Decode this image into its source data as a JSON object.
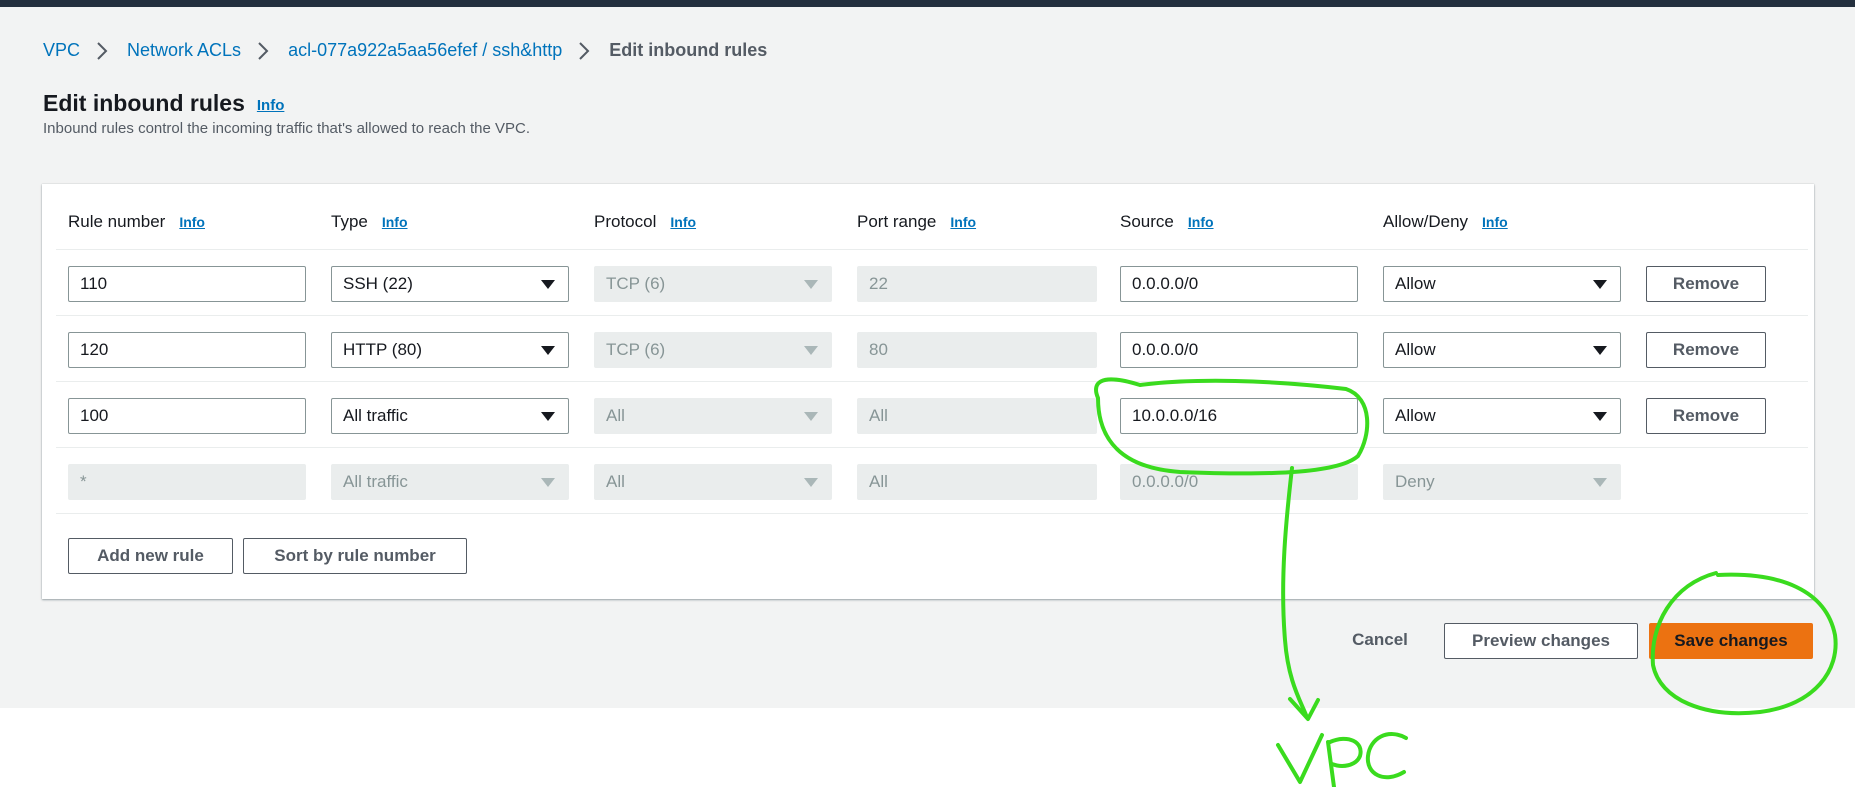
{
  "breadcrumb": {
    "items": [
      "VPC",
      "Network ACLs",
      "acl-077a922a5aa56efef / ssh&http"
    ],
    "current": "Edit inbound rules"
  },
  "page": {
    "title": "Edit inbound rules",
    "info": "Info",
    "subtitle": "Inbound rules control the incoming traffic that's allowed to reach the VPC."
  },
  "table": {
    "columns": [
      {
        "label": "Rule number",
        "info": "Info"
      },
      {
        "label": "Type",
        "info": "Info"
      },
      {
        "label": "Protocol",
        "info": "Info"
      },
      {
        "label": "Port range",
        "info": "Info"
      },
      {
        "label": "Source",
        "info": "Info"
      },
      {
        "label": "Allow/Deny",
        "info": "Info"
      }
    ],
    "rows": [
      {
        "rule_number": "110",
        "type": "SSH (22)",
        "protocol": "TCP (6)",
        "port_range": "22",
        "source": "0.0.0.0/0",
        "action": "Allow",
        "remove": "Remove"
      },
      {
        "rule_number": "120",
        "type": "HTTP (80)",
        "protocol": "TCP (6)",
        "port_range": "80",
        "source": "0.0.0.0/0",
        "action": "Allow",
        "remove": "Remove"
      },
      {
        "rule_number": "100",
        "type": "All traffic",
        "protocol": "All",
        "port_range": "All",
        "source": "10.0.0.0/16",
        "action": "Allow",
        "remove": "Remove"
      },
      {
        "rule_number": "*",
        "type": "All traffic",
        "protocol": "All",
        "port_range": "All",
        "source": "0.0.0.0/0",
        "action": "Deny"
      }
    ],
    "add_rule": "Add new rule",
    "sort_rules": "Sort by rule number"
  },
  "footer": {
    "cancel": "Cancel",
    "preview": "Preview changes",
    "save": "Save changes"
  },
  "annotation": {
    "color": "#3adb1e",
    "text": "VPC"
  }
}
